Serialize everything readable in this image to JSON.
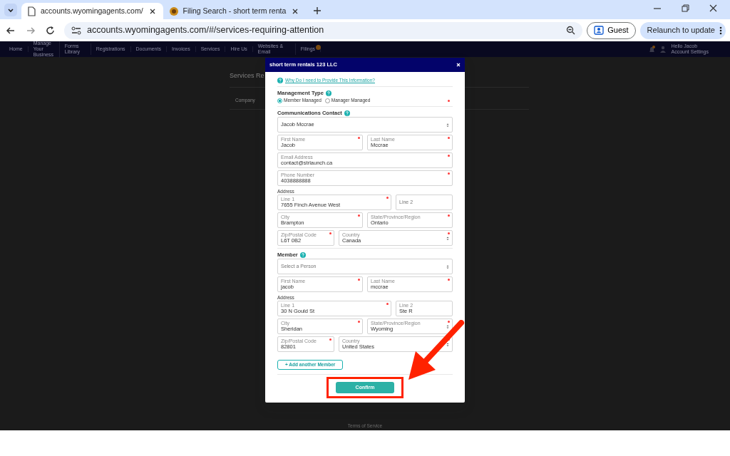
{
  "browser": {
    "tabs": [
      {
        "title": "accounts.wyomingagents.com/",
        "selected": true
      },
      {
        "title": "Filing Search - short term renta",
        "selected": false
      }
    ],
    "url": "accounts.wyomingagents.com/#/services-requiring-attention",
    "profile": "Guest",
    "update_button": "Relaunch to update"
  },
  "site_nav": {
    "items": [
      {
        "label": "Home",
        "badge": false
      },
      {
        "label": "Manage Your Business",
        "badge": false
      },
      {
        "label": "Forms Library",
        "badge": false
      },
      {
        "label": "Registrations",
        "badge": false
      },
      {
        "label": "Documents",
        "badge": false
      },
      {
        "label": "Invoices",
        "badge": false
      },
      {
        "label": "Services",
        "badge": false
      },
      {
        "label": "Hire Us",
        "badge": false
      },
      {
        "label": "Websites & Email",
        "badge": false
      },
      {
        "label": "Filings",
        "badge": true
      }
    ],
    "greeting": "Hello Jacob",
    "account_link": "Account Settings"
  },
  "page": {
    "heading": "Services Re",
    "column": "Company",
    "footer": "Terms of Service"
  },
  "modal": {
    "title": "short term rentals 123 LLC",
    "items": [
      {
        "kind": "link",
        "text": "Why Do I need to Provide This Information?"
      },
      {
        "kind": "divider"
      },
      {
        "kind": "heading",
        "text": "Management Type"
      },
      {
        "kind": "radios",
        "required": true,
        "options": [
          {
            "label": "Member Managed",
            "selected": true
          },
          {
            "label": "Manager Managed",
            "selected": false
          }
        ]
      },
      {
        "kind": "divider"
      },
      {
        "kind": "heading",
        "text": "Communications Contact"
      },
      {
        "kind": "single",
        "fields": [
          {
            "kind": "select",
            "value": "Jacob Mccrae",
            "required": false
          }
        ]
      },
      {
        "kind": "pair",
        "fields": [
          {
            "kind": "text",
            "label": "First Name",
            "value": "Jacob",
            "required": true
          },
          {
            "kind": "text",
            "label": "Last Name",
            "value": "Mccrae",
            "required": true
          }
        ]
      },
      {
        "kind": "single",
        "fields": [
          {
            "kind": "text",
            "label": "Email Address",
            "value": "contact@strlaunch.ca",
            "required": true
          }
        ]
      },
      {
        "kind": "single",
        "fields": [
          {
            "kind": "text",
            "label": "Phone Number",
            "value": "4038888888",
            "required": true
          }
        ]
      },
      {
        "kind": "subheading",
        "text": "Address"
      },
      {
        "kind": "street",
        "fields": [
          {
            "kind": "text",
            "label": "Line 1",
            "value": "7655 Finch Avenue West",
            "required": true
          },
          {
            "kind": "text",
            "placeholder": "Line 2",
            "required": false
          }
        ]
      },
      {
        "kind": "pair",
        "fields": [
          {
            "kind": "text",
            "label": "City",
            "value": "Brampton",
            "required": true
          },
          {
            "kind": "text",
            "label": "State/Province/Region",
            "value": "Ontario",
            "required": true
          }
        ]
      },
      {
        "kind": "postal",
        "fields": [
          {
            "kind": "text",
            "label": "Zip/Postal Code",
            "value": "L6T 0B2",
            "required": true
          },
          {
            "kind": "select",
            "label": "Country",
            "value": "Canada",
            "required": true
          }
        ]
      },
      {
        "kind": "divider"
      },
      {
        "kind": "heading",
        "text": "Member"
      },
      {
        "kind": "single",
        "fields": [
          {
            "kind": "select",
            "placeholder": "Select a Person",
            "required": false
          }
        ]
      },
      {
        "kind": "pair",
        "fields": [
          {
            "kind": "text",
            "label": "First Name",
            "value": "jacob",
            "required": true
          },
          {
            "kind": "text",
            "label": "Last Name",
            "value": "mccrae",
            "required": true
          }
        ]
      },
      {
        "kind": "subheading",
        "text": "Address"
      },
      {
        "kind": "street",
        "fields": [
          {
            "kind": "text",
            "label": "Line 1",
            "value": "30 N Gould St",
            "required": true
          },
          {
            "kind": "text",
            "label": "Line 2",
            "value": "Ste R",
            "required": false
          }
        ]
      },
      {
        "kind": "pair",
        "fields": [
          {
            "kind": "text",
            "label": "City",
            "value": "Sheridan",
            "required": true
          },
          {
            "kind": "select",
            "label": "State/Province/Region",
            "value": "Wyoming",
            "required": true
          }
        ]
      },
      {
        "kind": "postal",
        "fields": [
          {
            "kind": "text",
            "label": "Zip/Postal Code",
            "value": "82801",
            "required": true
          },
          {
            "kind": "select",
            "label": "Country",
            "value": "United States",
            "required": true
          }
        ]
      },
      {
        "kind": "add_button",
        "text": "+ Add another Member"
      },
      {
        "kind": "divider"
      }
    ],
    "confirm": "Confirm"
  }
}
